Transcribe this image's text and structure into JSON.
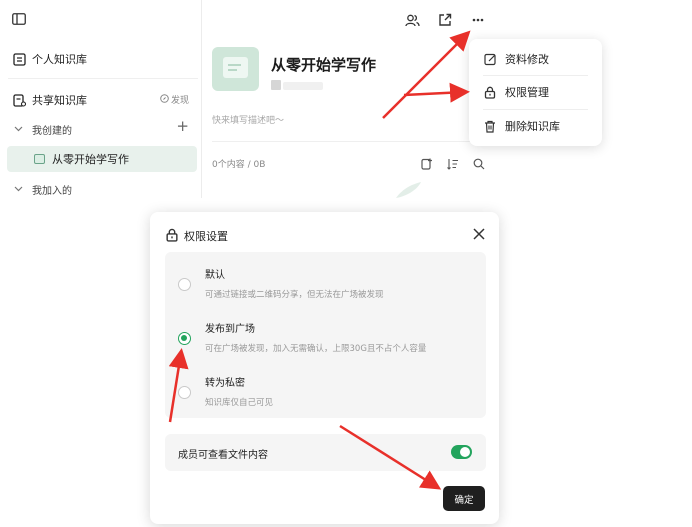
{
  "sidebar": {
    "personal_kb": "个人知识库",
    "shared_kb": "共享知识库",
    "discover": "发现",
    "created_by_me": "我创建的",
    "joined": "我加入的",
    "selected_kb": "从零开始学写作"
  },
  "main": {
    "kb_title": "从零开始学写作",
    "description_placeholder": "快来填写描述吧～",
    "stats": "0个内容 / 0B"
  },
  "menu": {
    "items": [
      {
        "label": "资料修改",
        "icon": "edit-icon"
      },
      {
        "label": "权限管理",
        "icon": "lock-icon"
      },
      {
        "label": "删除知识库",
        "icon": "trash-icon"
      }
    ]
  },
  "dialog": {
    "title": "权限设置",
    "options": [
      {
        "label": "默认",
        "desc": "可通过链接或二维码分享，但无法在广场被发现",
        "selected": false
      },
      {
        "label": "发布到广场",
        "desc": "可在广场被发现，加入无需确认，上限30G且不占个人容量",
        "selected": true
      },
      {
        "label": "转为私密",
        "desc": "知识库仅自己可见",
        "selected": false
      }
    ],
    "member_view_label": "成员可查看文件内容",
    "member_view_enabled": true,
    "confirm": "确定"
  },
  "colors": {
    "accent_green": "#23a45d",
    "arrow_red": "#e8302a",
    "cover_green": "#cfe6d9",
    "selected_bg": "#e8f1ec"
  }
}
